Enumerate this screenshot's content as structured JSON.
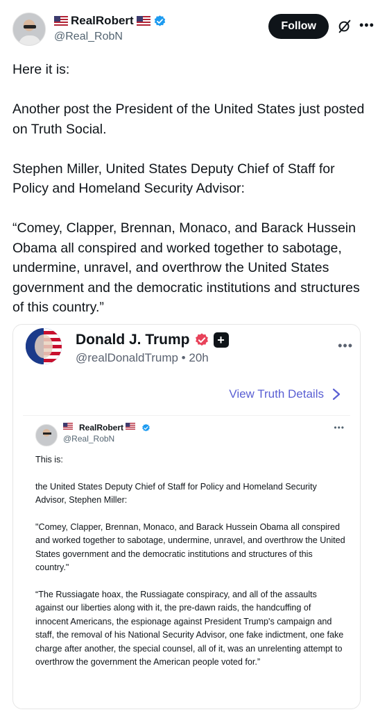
{
  "author": {
    "name": "RealRobert",
    "handle": "@Real_RobN",
    "verified": true
  },
  "header": {
    "follow_label": "Follow",
    "icons": [
      "grok-icon",
      "more-icon"
    ]
  },
  "post": {
    "text": "Here it is:\n\nAnother post the President of the United States just posted on Truth Social.\n\nStephen Miller, United States Deputy Chief of Staff for Policy and Homeland Security Advisor:\n\n“Comey, Clapper, Brennan, Monaco, and Barack Hussein Obama all conspired and worked together to sabotage, undermine, unravel, and overthrow the United States government and the democratic institutions and structures of this country.”"
  },
  "embed": {
    "name": "Donald J. Trump",
    "handle_time": "@realDonaldTrump • 20h",
    "view_details_label": "View Truth Details",
    "inner": {
      "name": "RealRobert",
      "handle": "@Real_RobN",
      "text": "This is:\n\nthe United States Deputy Chief of Staff for Policy and Homeland Security Advisor, Stephen Miller:\n\n\"Comey, Clapper, Brennan, Monaco, and Barack Hussein Obama all conspired and worked together to sabotage, undermine, unravel, and overthrow the United States government and the democratic institutions and structures of this country.\"\n\n“The Russiagate hoax, the Russiagate conspiracy, and all of the assaults against our liberties along with it, the pre-dawn raids, the handcuffing of innocent Americans, the espionage against President Trump's campaign and staff, the removal of his National Security Advisor, one fake indictment, one fake charge after another, the special counsel, all of it, was an unrelenting attempt to overthrow the government the American people voted for.”"
    }
  },
  "colors": {
    "follow_bg": "#0f1419",
    "verified_blue": "#1d9bf0",
    "truth_link": "#5a5fd3",
    "truth_badge": "#e8425a"
  }
}
